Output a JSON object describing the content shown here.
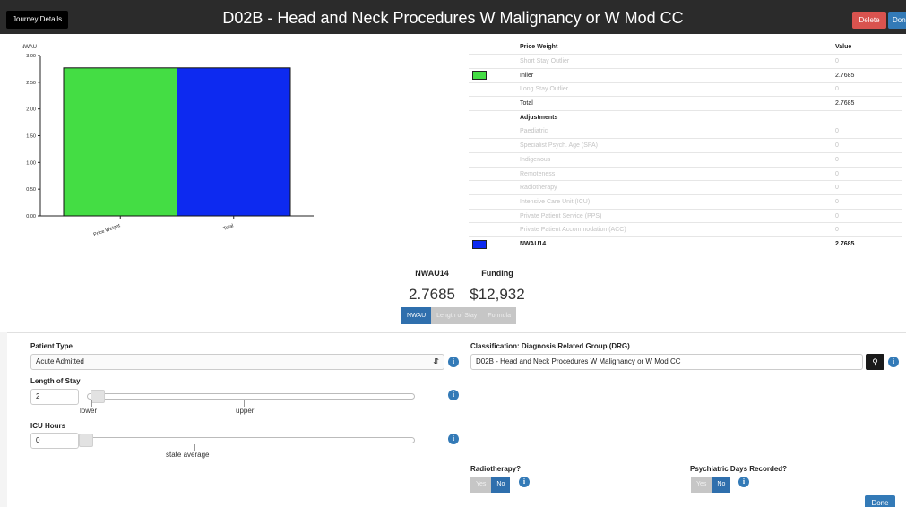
{
  "header": {
    "journey_label": "Journey Details",
    "title": "D02B - Head and Neck Procedures W Malignancy or W Mod CC",
    "delete_label": "Delete",
    "done_label": "Done"
  },
  "chart_data": {
    "type": "bar",
    "ylabel": "NWAU",
    "categories": [
      "Price Weight",
      "Total"
    ],
    "values": [
      2.7685,
      2.7685
    ],
    "colors": [
      "#44dd44",
      "#0d2af0"
    ],
    "ylim": [
      0,
      3
    ],
    "yticks": [
      "0.00",
      "0.50",
      "1.00",
      "1.50",
      "2.00",
      "2.50",
      "3.00"
    ],
    "grid": false
  },
  "price_table": {
    "col_name": "Price Weight",
    "col_value": "Value",
    "adjustments_label": "Adjustments",
    "rows": [
      {
        "name": "Short Stay Outlier",
        "value": "0"
      },
      {
        "name": "Inlier",
        "value": "2.7685",
        "swatch": "#44dd44"
      },
      {
        "name": "Long Stay Outlier",
        "value": "0"
      },
      {
        "name": "Total",
        "value": "2.7685"
      }
    ],
    "adjustments": [
      {
        "name": "Paediatric",
        "value": "0"
      },
      {
        "name": "Specialist Psych. Age (SPA)",
        "value": "0"
      },
      {
        "name": "Indigenous",
        "value": "0"
      },
      {
        "name": "Remoteness",
        "value": "0"
      },
      {
        "name": "Radiotherapy",
        "value": "0"
      },
      {
        "name": "Intensive Care Unit (ICU)",
        "value": "0"
      },
      {
        "name": "Private Patient Service (PPS)",
        "value": "0"
      },
      {
        "name": "Private Patient Accommodation (ACC)",
        "value": "0"
      }
    ],
    "final": {
      "name": "NWAU14",
      "value": "2.7685",
      "swatch": "#0d2af0"
    }
  },
  "summary": {
    "nwau_label": "NWAU14",
    "nwau_value": "2.7685",
    "funding_label": "Funding",
    "funding_value": "$12,932"
  },
  "tabs": [
    {
      "label": "NWAU",
      "active": true
    },
    {
      "label": "Length of Stay",
      "active": false
    },
    {
      "label": "Formula",
      "active": false
    }
  ],
  "form": {
    "patient_type_label": "Patient Type",
    "patient_type_value": "Acute Admitted",
    "los_label": "Length of Stay",
    "los_value": "2",
    "los_lower": "lower",
    "los_upper": "upper",
    "icu_label": "ICU Hours",
    "icu_value": "0",
    "icu_marker": "state average",
    "drg_label": "Classification: Diagnosis Related Group (DRG)",
    "drg_value": "D02B - Head and Neck Procedures W Malignancy or W Mod CC",
    "radiotherapy_label": "Radiotherapy?",
    "psych_label": "Psychiatric Days Recorded?",
    "yes": "Yes",
    "no": "No",
    "done_label": "Done"
  }
}
